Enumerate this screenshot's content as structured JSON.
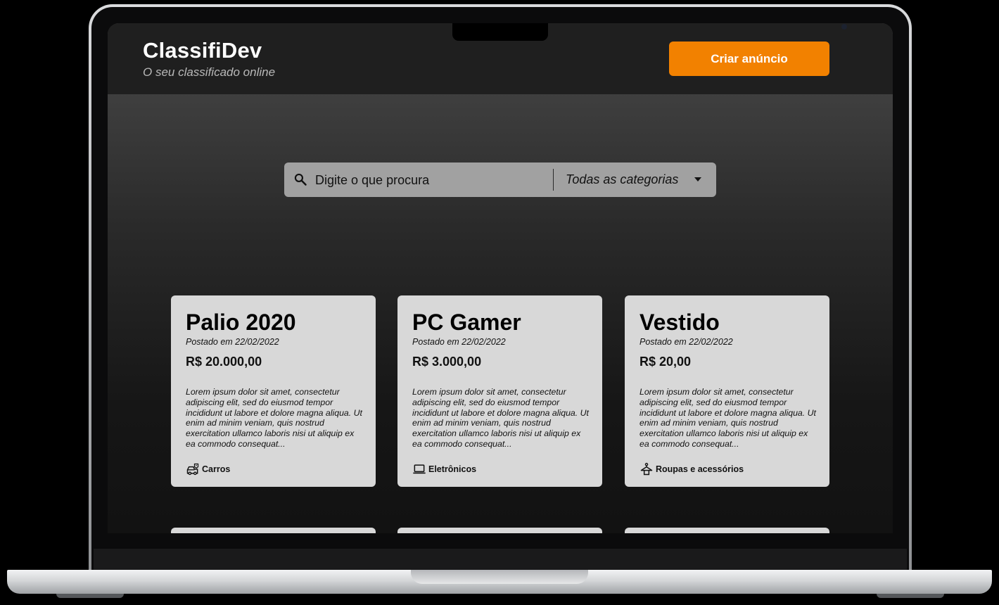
{
  "header": {
    "brand_title": "ClassifiDev",
    "brand_subtitle": "O seu classificado online",
    "create_button": "Criar anúncio"
  },
  "search": {
    "placeholder": "Digite o que procura",
    "icon": "search-icon",
    "category": "Todas as categorias",
    "category_icon": "caret-down-icon"
  },
  "listings": [
    {
      "title": "Palio 2020",
      "date": "Postado em 22/02/2022",
      "price": "R$ 20.000,00",
      "description": "Lorem ipsum dolor sit amet, consectetur adipiscing elit, sed do eiusmod tempor incididunt ut labore et dolore magna aliqua. Ut enim ad minim veniam, quis nostrud exercitation ullamco laboris nisi ut aliquip ex ea commodo consequat...",
      "category": "Carros",
      "category_icon": "car-icon"
    },
    {
      "title": "PC Gamer",
      "date": "Postado em 22/02/2022",
      "price": "R$ 3.000,00",
      "description": "Lorem ipsum dolor sit amet, consectetur adipiscing elit, sed do eiusmod tempor incididunt ut labore et dolore magna aliqua. Ut enim ad minim veniam, quis nostrud exercitation ullamco laboris nisi ut aliquip ex ea commodo consequat...",
      "category": "Eletrônicos",
      "category_icon": "laptop-icon"
    },
    {
      "title": "Vestido",
      "date": "Postado em 22/02/2022",
      "price": "R$ 20,00",
      "description": "Lorem ipsum dolor sit amet, consectetur adipiscing elit, sed do eiusmod tempor incididunt ut labore et dolore magna aliqua. Ut enim ad minim veniam, quis nostrud exercitation ullamco laboris nisi ut aliquip ex ea commodo consequat...",
      "category": "Roupas e acessórios",
      "category_icon": "hanger-icon"
    }
  ],
  "colors": {
    "accent": "#f28100",
    "header_bg": "#1f1f1f",
    "card_bg": "#d8d8d8",
    "search_bg": "#a1a1a1"
  }
}
